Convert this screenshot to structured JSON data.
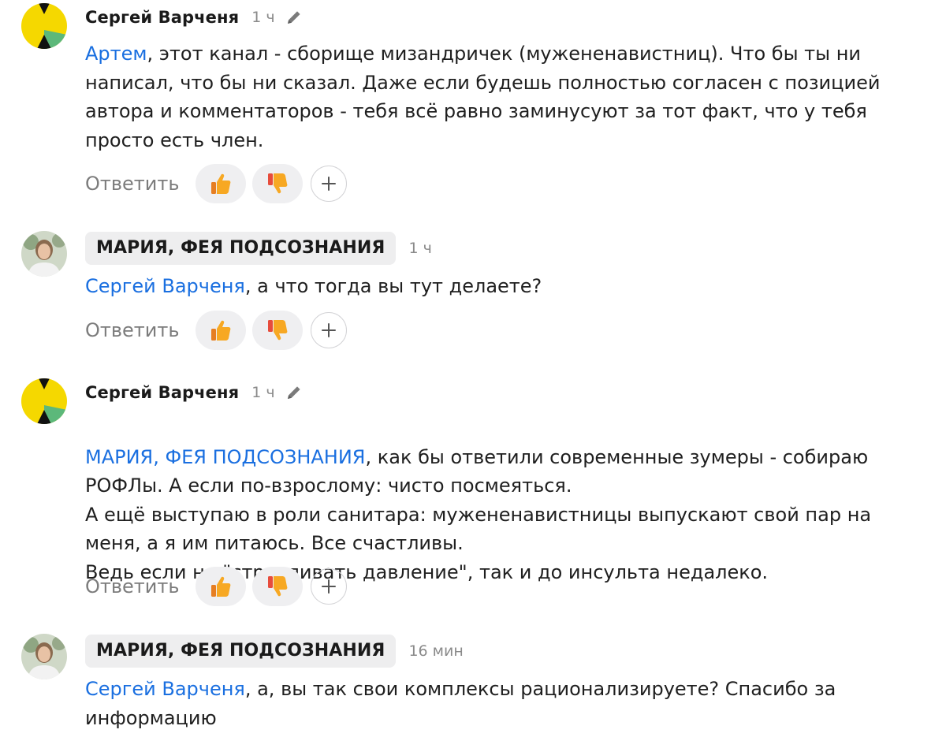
{
  "comments": [
    {
      "author": "Сергей Варченя",
      "time": "1 ч",
      "mention": "Артем",
      "text": ", этот канал - сборище мизандричек (мужененавистниц). Что бы ты ни написал, что бы ни сказал. Даже если будешь полностью согласен с позицией автора и комментаторов - тебя всё равно заминусуют за тот факт, что у тебя просто есть член.",
      "reply_label": "Ответить",
      "icons": {
        "avatar": "yellow-green-avatar-icon",
        "edit": "pencil-icon",
        "like": "thumbs-up-icon",
        "dislike": "thumbs-down-icon",
        "add": "plus-icon"
      }
    },
    {
      "author": "МАРИЯ, ФЕЯ ПОДСОЗНАНИЯ",
      "time": "1 ч",
      "mention": "Сергей Варченя",
      "text": ", а что тогда вы тут делаете?",
      "reply_label": "Ответить"
    },
    {
      "author": "Сергей Варченя",
      "time": "1 ч",
      "mention": "МАРИЯ, ФЕЯ ПОДСОЗНАНИЯ",
      "text": ", как бы ответили современные зумеры - собираю РОФЛы. А если по-взрослому: чисто посмеяться.\nА ещё выступаю в роли санитара: мужененавистницы выпускают свой пар на меня, а я им питаюсь. Все счастливы.\nВедь если не \"стравливать давление\", так и до инсульта недалеко.",
      "reply_label": "Ответить"
    },
    {
      "author": "МАРИЯ, ФЕЯ ПОДСОЗНАНИЯ",
      "time": "16 мин",
      "mention": "Сергей Варченя",
      "text": ", а, вы так свои комплексы рационализируете? Спасибо за информацию"
    }
  ],
  "colors": {
    "mention": "#1a6fe0",
    "chip_bg": "#eeeeef",
    "reaction_bg": "#efeff1",
    "avatar_yellow": "#f5d800",
    "avatar_green": "#5cb87a"
  }
}
